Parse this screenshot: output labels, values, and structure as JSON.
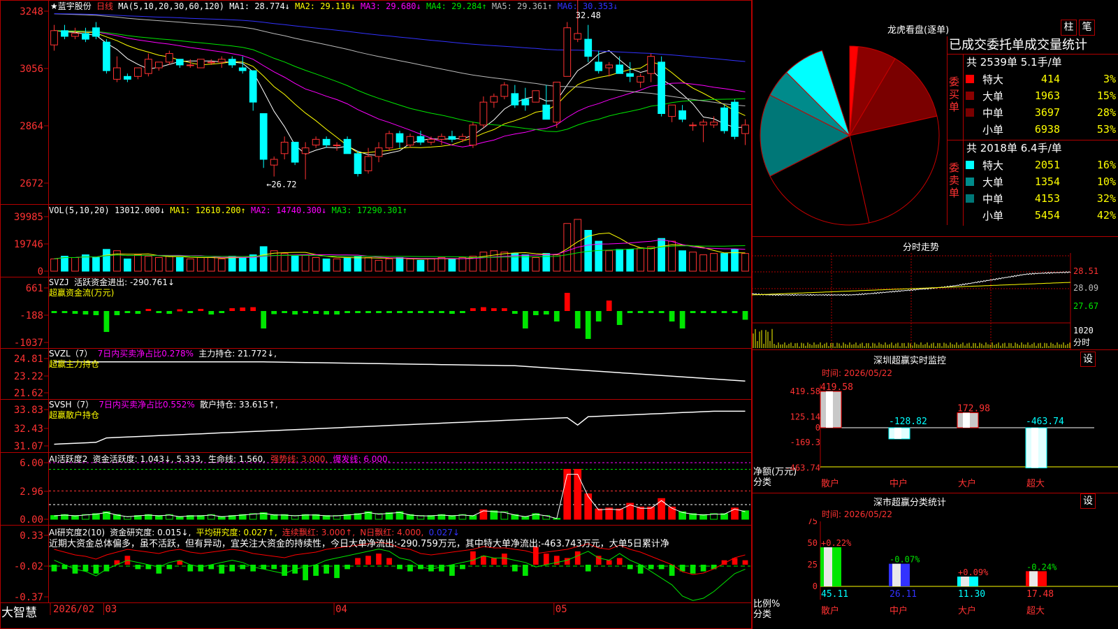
{
  "stock": {
    "title": "★蓝宇股份",
    "period": "日线",
    "ma_label": "MA(5,10,20,30,60,120)",
    "ma_values": [
      {
        "text": "MA1: 28.774↓",
        "color": "#ffffff"
      },
      {
        "text": "MA2: 29.110↓",
        "color": "#ffff00"
      },
      {
        "text": "MA3: 29.680↓",
        "color": "#ff00ff"
      },
      {
        "text": "MA4: 29.284↑",
        "color": "#00e600"
      },
      {
        "text": "MA5: 29.361↑",
        "color": "#bbbbbb"
      },
      {
        "text": "MA6: 30.353↓",
        "color": "#3232ff"
      }
    ],
    "y_labels": [
      "3248",
      "3056",
      "2864",
      "2672"
    ],
    "high_note": "32.48",
    "low_note": "←26.72"
  },
  "candles": [
    [
      31.6,
      32.3,
      31.4,
      32.1
    ],
    [
      32.1,
      32.3,
      31.8,
      31.9
    ],
    [
      31.9,
      32.2,
      31.8,
      32.0
    ],
    [
      32.0,
      32.2,
      31.7,
      31.8
    ],
    [
      32.2,
      32.4,
      31.8,
      31.9
    ],
    [
      31.7,
      31.8,
      30.6,
      30.7
    ],
    [
      30.4,
      31.2,
      30.3,
      30.8
    ],
    [
      30.5,
      30.6,
      30.3,
      30.4
    ],
    [
      30.5,
      30.8,
      30.4,
      30.8
    ],
    [
      30.6,
      31.3,
      30.5,
      31.1
    ],
    [
      30.8,
      31.0,
      30.7,
      31.0
    ],
    [
      31.0,
      31.4,
      30.9,
      31.3
    ],
    [
      31.1,
      31.1,
      30.8,
      30.9
    ],
    [
      30.9,
      31.1,
      30.8,
      30.9
    ],
    [
      30.8,
      31.1,
      30.8,
      31.1
    ],
    [
      31.0,
      31.1,
      30.9,
      31.0
    ],
    [
      31.0,
      31.2,
      30.8,
      31.1
    ],
    [
      31.1,
      31.2,
      30.8,
      30.9
    ],
    [
      30.8,
      31.2,
      30.6,
      30.7
    ],
    [
      30.7,
      30.7,
      29.3,
      29.6
    ],
    [
      29.2,
      29.2,
      27.3,
      27.6
    ],
    [
      27.4,
      27.7,
      27.0,
      27.6
    ],
    [
      27.8,
      28.4,
      27.6,
      28.2
    ],
    [
      28.2,
      28.2,
      27.4,
      27.5
    ],
    [
      27.8,
      28.2,
      26.9,
      28.0
    ],
    [
      28.1,
      28.4,
      28.0,
      28.3
    ],
    [
      28.3,
      28.4,
      28.0,
      28.1
    ],
    [
      28.1,
      28.2,
      27.9,
      28.1
    ],
    [
      28.3,
      28.4,
      27.8,
      27.8
    ],
    [
      27.8,
      27.9,
      27.0,
      27.1
    ],
    [
      27.2,
      28.0,
      27.1,
      27.7
    ],
    [
      27.7,
      28.2,
      27.5,
      28.0
    ],
    [
      28.0,
      28.6,
      27.9,
      28.5
    ],
    [
      28.5,
      28.6,
      28.0,
      28.2
    ],
    [
      28.1,
      28.5,
      28.0,
      28.4
    ],
    [
      28.4,
      28.6,
      28.1,
      28.2
    ],
    [
      28.2,
      28.4,
      28.1,
      28.3
    ],
    [
      28.3,
      28.5,
      28.1,
      28.4
    ],
    [
      28.4,
      28.6,
      28.2,
      28.3
    ],
    [
      28.3,
      28.5,
      28.2,
      28.4
    ],
    [
      28.1,
      28.9,
      28.0,
      28.8
    ],
    [
      28.8,
      29.8,
      28.7,
      29.6
    ],
    [
      29.6,
      29.9,
      29.4,
      29.8
    ],
    [
      29.8,
      30.3,
      29.7,
      30.2
    ],
    [
      29.9,
      30.2,
      29.4,
      29.5
    ],
    [
      29.7,
      30.1,
      29.3,
      29.5
    ],
    [
      29.6,
      30.0,
      29.7,
      30.0
    ],
    [
      29.5,
      30.2,
      29.0,
      29.0
    ],
    [
      28.9,
      30.3,
      28.7,
      30.3
    ],
    [
      30.5,
      32.4,
      30.5,
      32.2
    ],
    [
      31.8,
      33.3,
      31.7,
      32.0
    ],
    [
      31.8,
      32.3,
      31.0,
      31.2
    ],
    [
      31.0,
      31.4,
      30.6,
      30.7
    ],
    [
      30.8,
      31.0,
      30.5,
      30.9
    ],
    [
      30.9,
      31.2,
      30.6,
      30.6
    ],
    [
      30.6,
      31.0,
      30.3,
      30.5
    ],
    [
      30.3,
      30.6,
      30.1,
      30.5
    ],
    [
      30.6,
      31.3,
      30.3,
      31.2
    ],
    [
      31.0,
      31.2,
      29.1,
      29.2
    ],
    [
      29.1,
      29.5,
      28.9,
      29.5
    ],
    [
      29.3,
      29.5,
      28.9,
      29.0
    ],
    [
      28.8,
      28.9,
      28.6,
      28.8
    ],
    [
      28.8,
      29.0,
      28.2,
      28.9
    ],
    [
      28.8,
      29.1,
      28.7,
      28.9
    ],
    [
      29.4,
      29.5,
      28.5,
      28.6
    ],
    [
      29.6,
      29.7,
      28.3,
      28.4
    ],
    [
      28.5,
      29.0,
      28.1,
      28.8
    ]
  ],
  "vol_panel": {
    "label": "VOL(5,10,20)",
    "values": [
      {
        "text": "13012.000↓",
        "color": "#ffffff"
      },
      {
        "text": "MA1: 12610.200↑",
        "color": "#ffff00"
      },
      {
        "text": "MA2: 14740.300↓",
        "color": "#ff00ff"
      },
      {
        "text": "MA3: 17290.301↑",
        "color": "#00e600"
      }
    ],
    "y_labels": [
      "39985",
      "19746",
      "0"
    ],
    "vols": [
      9,
      11,
      10,
      12,
      10,
      16,
      15,
      9,
      12,
      11,
      10,
      11,
      10,
      9,
      10,
      10,
      9,
      11,
      10,
      12,
      18,
      15,
      13,
      11,
      12,
      10,
      9,
      9,
      10,
      11,
      10,
      8,
      9,
      10,
      9,
      8,
      9,
      10,
      9,
      10,
      11,
      14,
      15,
      14,
      13,
      12,
      10,
      13,
      12,
      35,
      38,
      30,
      22,
      15,
      16,
      16,
      17,
      18,
      24,
      22,
      15,
      14,
      12,
      13,
      13,
      16,
      13
    ]
  },
  "svzj_panel": {
    "label": "SVZJ",
    "text1": "活跃资金进出: -290.761↓",
    "text2": "超赢资金流(万元)",
    "y_labels": [
      "661",
      "-188",
      "-1037"
    ],
    "vals": [
      -50,
      -60,
      -80,
      -100,
      -120,
      -600,
      -120,
      -40,
      -80,
      60,
      -40,
      -80,
      50,
      -60,
      60,
      -100,
      -60,
      80,
      100,
      110,
      -500,
      -90,
      -50,
      -100,
      -40,
      -80,
      -100,
      -100,
      -60,
      -40,
      -60,
      -50,
      -50,
      -40,
      -60,
      -40,
      -40,
      -60,
      -80,
      -50,
      80,
      110,
      80,
      80,
      -80,
      -500,
      -120,
      -100,
      -300,
      520,
      -500,
      -800,
      -300,
      300,
      -400,
      -60,
      -60,
      -50,
      -40,
      -300,
      -500,
      -40,
      -40,
      -50,
      -40,
      -50,
      -250
    ]
  },
  "svzl_panel": {
    "label": "SVZL（7）",
    "text1": "7日内买卖净占比0.278%",
    "text2": "主力持仓: 21.772↓,",
    "text3": "超赢主力持仓",
    "y_labels": [
      "24.81",
      "23.22",
      "21.62"
    ]
  },
  "svsh_panel": {
    "label": "SVSH（7）",
    "text1": "7日内买卖净占比0.552%",
    "text2": "散户持仓: 33.615↑,",
    "text3": "超赢散户持仓",
    "y_labels": [
      "33.83",
      "32.43",
      "31.07"
    ]
  },
  "ai_active_panel": {
    "label": "AI活跃度2",
    "text1": "资金活跃度: 1.043↓, 5.333,",
    "text2": "生命线: 1.560,",
    "text3": "强势线: 3.000,",
    "text4": "爆发线: 6.000,",
    "y_labels": [
      "6.00",
      "2.96",
      "0.00"
    ],
    "vals": [
      0.4,
      0.5,
      0.4,
      0.5,
      0.6,
      0.8,
      0.5,
      0.3,
      0.4,
      0.5,
      0.4,
      0.5,
      0.3,
      0.4,
      0.4,
      0.5,
      0.3,
      0.4,
      0.5,
      0.6,
      0.7,
      0.5,
      0.5,
      0.4,
      0.5,
      0.5,
      0.4,
      0.4,
      0.5,
      0.6,
      0.8,
      0.6,
      0.7,
      0.8,
      0.5,
      0.4,
      0.4,
      0.5,
      0.4,
      0.5,
      0.4,
      1.0,
      0.9,
      0.8,
      0.5,
      0.3,
      0.6,
      0.4,
      0.1,
      5.3,
      5.3,
      2.7,
      1.1,
      1.2,
      1.1,
      1.7,
      1.3,
      1.3,
      2.2,
      1.3,
      0.8,
      0.6,
      0.5,
      0.6,
      0.6,
      1.2,
      0.9
    ]
  },
  "ai_research_panel": {
    "label": "AI研究度2(10)",
    "text1": "资金研究度: 0.015↓,",
    "text2": "平均研究度: 0.027↑,",
    "text3": "连续飘红: 3.000↑,",
    "text4": "N日飘红: 4.000,",
    "text5": "0.027↓",
    "summary": "近期大资金总体偏多，虽不活跃，但有异动，宜关注大资金的持续性，今日大单净流出:-290.759万元，其中特大单净流出:-463.743万元，大单5日累计净",
    "y_labels": [
      "0.33",
      "-0.02",
      "-0.37"
    ],
    "vals": [
      -0.03,
      -0.02,
      -0.04,
      -0.03,
      -0.04,
      -0.03,
      0.02,
      0.04,
      -0.02,
      -0.02,
      -0.04,
      -0.02,
      0.02,
      -0.03,
      -0.03,
      -0.02,
      -0.04,
      -0.03,
      -0.02,
      -0.03,
      -0.02,
      -0.02,
      -0.05,
      -0.04,
      -0.07,
      -0.05,
      -0.04,
      -0.06,
      -0.02,
      0.03,
      0.04,
      0.05,
      0.03,
      -0.02,
      -0.03,
      -0.02,
      -0.03,
      -0.03,
      -0.05,
      -0.02,
      0.06,
      0.04,
      0.03,
      0.05,
      -0.03,
      -0.05,
      0.08,
      0.05,
      0.04,
      0.03,
      0.06,
      -0.03,
      0.04,
      0.02,
      0.03,
      -0.02,
      -0.04,
      -0.02,
      -0.02,
      -0.05,
      -0.03,
      -0.04,
      -0.03,
      -0.02,
      0.02,
      0.03,
      0.02
    ]
  },
  "bottom_axis": {
    "brand": "大智慧",
    "labels": [
      {
        "text": "2026/02",
        "i": 0
      },
      {
        "text": "03",
        "i": 5
      },
      {
        "text": "04",
        "i": 27
      },
      {
        "text": "05",
        "i": 48
      }
    ]
  },
  "right_panel": {
    "lhb_title": "龙虎看盘(逐单)",
    "btn1": "柱",
    "btn2": "笔",
    "stats_title": "已成交委托单成交量统计",
    "buy_summary": "共 2539单 5.1手/单",
    "buy_label": "委买单",
    "buy_rows": [
      {
        "name": "特大",
        "count": "414",
        "pct": "3%",
        "color": "#ff0000"
      },
      {
        "name": "大单",
        "count": "1963",
        "pct": "15%",
        "color": "#8b0000"
      },
      {
        "name": "中单",
        "count": "3697",
        "pct": "28%",
        "color": "#7a0000"
      },
      {
        "name": "小单",
        "count": "6938",
        "pct": "53%",
        "color": "#000000"
      }
    ],
    "sell_summary": "共 2018单 6.4手/单",
    "sell_label": "委卖单",
    "sell_rows": [
      {
        "name": "特大",
        "count": "2051",
        "pct": "16%",
        "color": "#00ffff"
      },
      {
        "name": "大单",
        "count": "1354",
        "pct": "10%",
        "color": "#008b8b"
      },
      {
        "name": "中单",
        "count": "4153",
        "pct": "32%",
        "color": "#007777"
      },
      {
        "name": "小单",
        "count": "5454",
        "pct": "42%",
        "color": "#000000"
      }
    ],
    "pie_slices": [
      {
        "share": 0.015,
        "color": "#ff0000"
      },
      {
        "share": 0.07,
        "color": "#8b0000"
      },
      {
        "share": 0.13,
        "color": "#7a0000"
      },
      {
        "share": 0.25,
        "color": "#000000"
      },
      {
        "share": 0.21,
        "color": "#000000"
      },
      {
        "share": 0.15,
        "color": "#007777"
      },
      {
        "share": 0.05,
        "color": "#008b8b"
      },
      {
        "share": 0.075,
        "color": "#00ffff"
      }
    ],
    "intraday_title": "分时走势",
    "intraday_y": [
      "28.51",
      "28.09",
      "27.67"
    ],
    "intraday_vol_label": "1020",
    "intraday_unit": "分时",
    "sz_monitor_title": "深圳超赢实时监控",
    "sz_btn": "设",
    "sz_time": "时间: 2026/05/22",
    "sz_y": [
      "419.58",
      "125.14",
      "0",
      "-169.3",
      "-463.74"
    ],
    "sz_axis_label": "净额(万元)",
    "sz_axis_label2": "分类",
    "sz_bars": [
      {
        "cat": "散户",
        "value": 419.58,
        "label": "419.58",
        "type": "pos"
      },
      {
        "cat": "中户",
        "value": -128.82,
        "label": "-128.82",
        "type": "neg"
      },
      {
        "cat": "大户",
        "value": 172.98,
        "label": "172.98",
        "type": "pos"
      },
      {
        "cat": "超大",
        "value": -463.74,
        "label": "-463.74",
        "type": "neg"
      }
    ],
    "cls_title": "深市超赢分类统计",
    "cls_btn": "设",
    "cls_time": "时间: 2026/05/22",
    "cls_y": [
      "75",
      "50",
      "25",
      "0"
    ],
    "cls_axis_label": "比例%",
    "cls_axis_label2": "分类",
    "cls_bars": [
      {
        "cat": "散户",
        "value": 45.11,
        "label": "45.11",
        "chg": "+0.22%",
        "type": "green"
      },
      {
        "cat": "中户",
        "value": 26.11,
        "label": "26.11",
        "chg": "-0.07%",
        "type": "blue"
      },
      {
        "cat": "大户",
        "value": 11.3,
        "label": "11.30",
        "chg": "+0.09%",
        "type": "cyan"
      },
      {
        "cat": "超大",
        "value": 17.48,
        "label": "17.48",
        "chg": "-0.24%",
        "type": "red"
      }
    ]
  }
}
